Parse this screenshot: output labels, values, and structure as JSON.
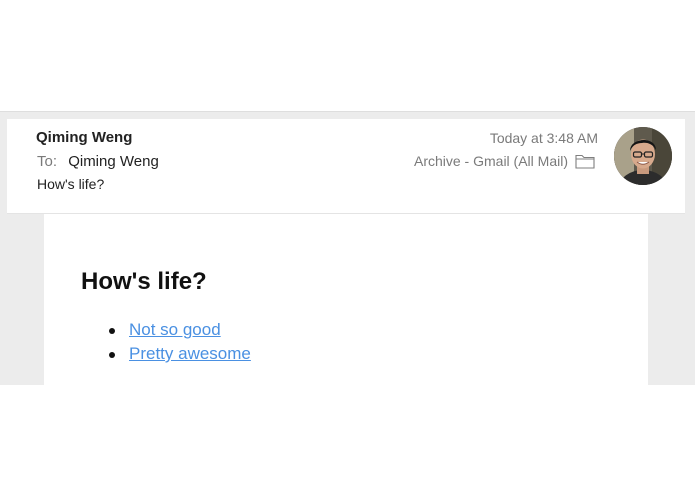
{
  "header": {
    "sender": "Qiming Weng",
    "to_label": "To:",
    "to": "Qiming Weng",
    "subject": "How's life?",
    "date": "Today at 3:48 AM",
    "mailbox": "Archive - Gmail (All Mail)",
    "mailbox_icon": "folder-icon",
    "avatar_icon": "avatar-photo"
  },
  "body": {
    "title": "How's life?",
    "options": [
      {
        "label": "Not so good"
      },
      {
        "label": "Pretty awesome"
      }
    ],
    "link_color": "#4a90e2"
  }
}
